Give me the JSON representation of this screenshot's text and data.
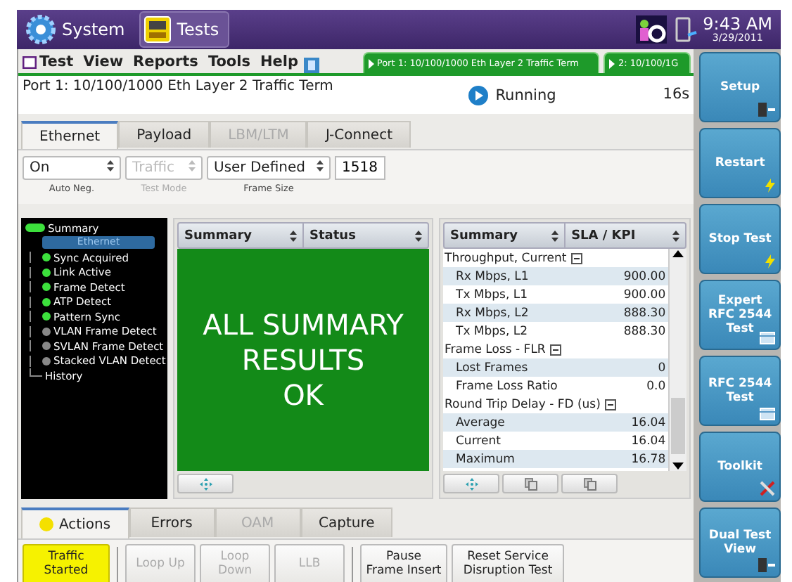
{
  "top_bar": {
    "system": "System",
    "tests": "Tests",
    "time": "9:43 AM",
    "date": "3/29/2011"
  },
  "menu": [
    "Test",
    "View",
    "Reports",
    "Tools",
    "Help"
  ],
  "port_tabs": [
    {
      "label": "Port 1: 10/100/1000 Eth Layer 2 Traffic Term"
    },
    {
      "label": "2: 10/100/1G"
    }
  ],
  "info": {
    "title": "Port 1: 10/100/1000 Eth Layer 2 Traffic Term",
    "status": "Running",
    "elapsed": "16s"
  },
  "config_tabs": [
    {
      "label": "Ethernet",
      "selected": true,
      "disabled": false
    },
    {
      "label": "Payload",
      "selected": false,
      "disabled": false
    },
    {
      "label": "LBM/LTM",
      "selected": false,
      "disabled": true
    },
    {
      "label": "J-Connect",
      "selected": false,
      "disabled": false
    }
  ],
  "fields": [
    {
      "kind": "select",
      "value": "On",
      "label": "Auto Neg.",
      "disabled": false
    },
    {
      "kind": "select",
      "value": "Traffic",
      "label": "Test Mode",
      "disabled": true
    },
    {
      "kind": "select",
      "value": "User Defined",
      "label": "Frame Size",
      "disabled": false
    },
    {
      "kind": "input",
      "value": "1518",
      "disabled": false
    }
  ],
  "tree": {
    "label": "Summary",
    "led": true,
    "children": [
      {
        "kind": "category",
        "label": "Ethernet",
        "selected": true
      },
      {
        "kind": "led",
        "label": "Sync Acquired",
        "led": true,
        "selected": false
      },
      {
        "kind": "led",
        "label": "Link Active",
        "led": true,
        "selected": false
      },
      {
        "kind": "led",
        "label": "Frame Detect",
        "led": true,
        "selected": false
      },
      {
        "kind": "led",
        "label": "ATP Detect",
        "led": true,
        "selected": false
      },
      {
        "kind": "led",
        "label": "Pattern Sync",
        "led": true,
        "selected": false
      },
      {
        "kind": "led",
        "label": "VLAN Frame Detect",
        "led": false,
        "selected": false
      },
      {
        "kind": "led",
        "label": "SVLAN Frame Detect",
        "led": false,
        "selected": false
      },
      {
        "kind": "led",
        "label": "Stacked VLAN Detect",
        "led": false,
        "selected": false
      },
      {
        "kind": "plain",
        "label": "History",
        "selected": false
      }
    ]
  },
  "left_panel": {
    "headers": [
      "Summary",
      "Status"
    ],
    "message": [
      "ALL SUMMARY",
      "RESULTS",
      "OK"
    ]
  },
  "right_panel": {
    "headers": [
      "Summary",
      "SLA / KPI"
    ],
    "groups": [
      {
        "title": "Throughput, Current",
        "expanded": true,
        "rows": [
          [
            "Rx Mbps, L1",
            "900.00"
          ],
          [
            "Tx Mbps, L1",
            "900.00"
          ],
          [
            "Rx Mbps, L2",
            "888.30"
          ],
          [
            "Tx Mbps, L2",
            "888.30"
          ]
        ]
      },
      {
        "title": "Frame Loss - FLR",
        "expanded": true,
        "rows": [
          [
            "Lost Frames",
            "0"
          ],
          [
            "Frame Loss Ratio",
            "0.0"
          ]
        ]
      },
      {
        "title": "Round Trip Delay - FD (us)",
        "expanded": true,
        "rows": [
          [
            "Average",
            "16.04"
          ],
          [
            "Current",
            "16.04"
          ],
          [
            "Maximum",
            "16.78"
          ]
        ]
      }
    ]
  },
  "bottom_tabs": [
    {
      "label": "Actions",
      "selected": true,
      "disabled": false
    },
    {
      "label": "Errors",
      "selected": false,
      "disabled": false
    },
    {
      "label": "OAM",
      "selected": false,
      "disabled": true
    },
    {
      "label": "Capture",
      "selected": false,
      "disabled": false
    }
  ],
  "action_groups": [
    [
      {
        "label": "Traffic Started",
        "on": true,
        "disabled": false
      }
    ],
    [
      {
        "label": "Loop Up",
        "on": false,
        "disabled": true
      },
      {
        "label": "Loop Down",
        "on": false,
        "disabled": true
      },
      {
        "label": "LLB",
        "on": false,
        "disabled": true
      }
    ],
    [
      {
        "label": "Pause Frame Insert",
        "on": false,
        "disabled": false
      },
      {
        "label": "Reset Service Disruption Test",
        "on": false,
        "disabled": false
      }
    ]
  ],
  "side_buttons": [
    {
      "label": "Setup",
      "kind": "launch"
    },
    {
      "label": "Restart",
      "kind": "action"
    },
    {
      "label": "Stop Test",
      "kind": "action"
    },
    {
      "label": "Expert RFC 2544 Test",
      "kind": "view"
    },
    {
      "label": "RFC 2544 Test",
      "kind": "view"
    },
    {
      "label": "Toolkit",
      "kind": "tool"
    },
    {
      "label": "Dual Test View",
      "kind": "launch"
    }
  ]
}
